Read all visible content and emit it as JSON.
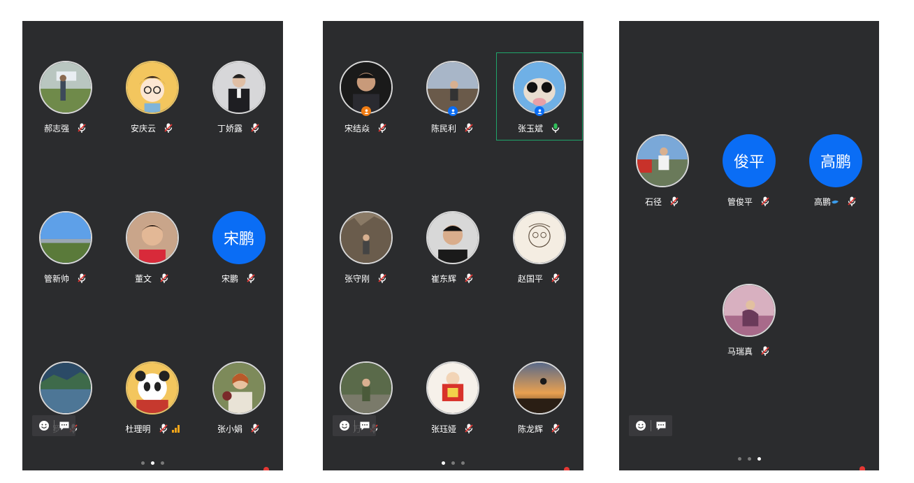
{
  "panels": [
    {
      "participants": [
        {
          "name": "郝志强"
        },
        {
          "name": "安庆云"
        },
        {
          "name": "丁娇露"
        },
        {
          "name": "管新帅"
        },
        {
          "name": "董文"
        },
        {
          "name": "宋鹏",
          "avatar_text": "宋鹏"
        },
        {
          "name": "罗"
        },
        {
          "name": "杜理明"
        },
        {
          "name": "张小娟"
        }
      ]
    },
    {
      "participants": [
        {
          "name": "宋结焱",
          "badge_color": "#f07c13"
        },
        {
          "name": "陈民利",
          "badge_color": "#0a6df5"
        },
        {
          "name": "张玉斌",
          "badge_color": "#0a6df5",
          "mic_state": "active"
        },
        {
          "name": "张守刚"
        },
        {
          "name": "崔东辉"
        },
        {
          "name": "赵国平"
        },
        {
          "name": "万"
        },
        {
          "name": "张珏娅"
        },
        {
          "name": "陈龙辉"
        }
      ]
    },
    {
      "participants": [
        {
          "name": "石径"
        },
        {
          "name": "管俊平",
          "avatar_text": "俊平"
        },
        {
          "name": "高鹏",
          "avatar_text": "高鹏"
        },
        {
          "name": "马瑞真"
        }
      ]
    }
  ],
  "colors": {
    "panel_bg": "#2b2c2e",
    "text_avatar_bg": "#0a6df5",
    "muted_mic": "#e53935",
    "active_mic": "#2fbf5a",
    "speaker_border": "#1fa56a",
    "signal": "#f2a51a"
  },
  "icons": [
    "emoji-icon",
    "chat-icon",
    "mic-muted-icon",
    "mic-icon",
    "signal-bars-icon",
    "host-badge-icon"
  ],
  "pagination": {
    "total": 3
  }
}
